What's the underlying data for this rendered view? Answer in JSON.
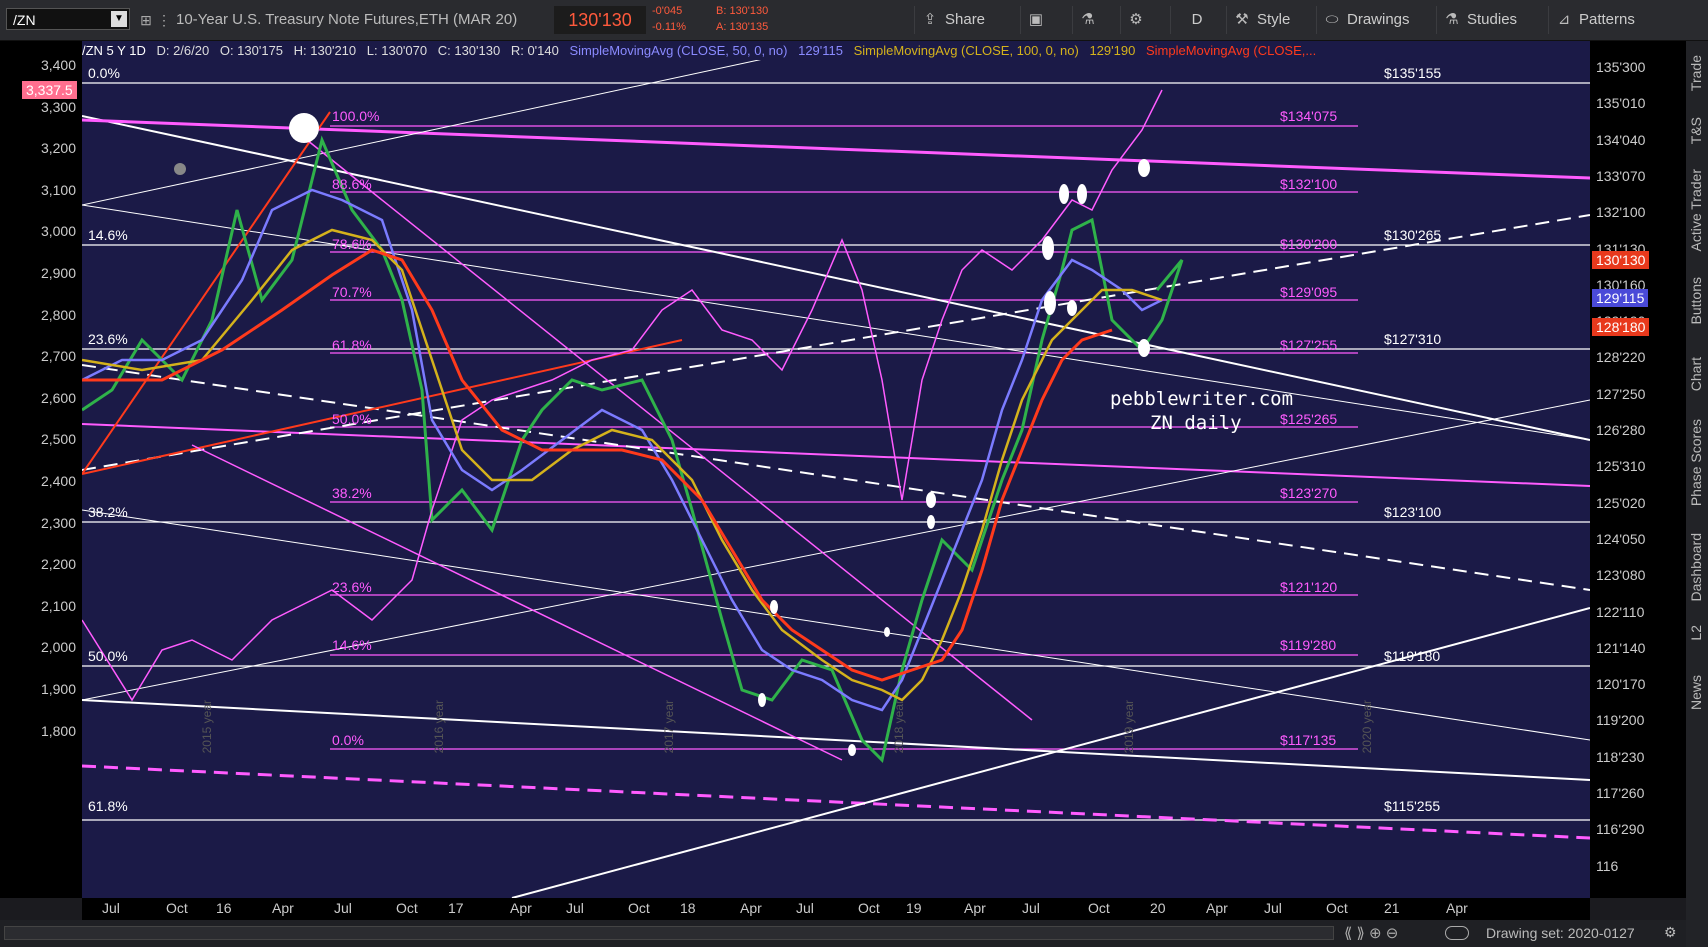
{
  "toolbar": {
    "symbol": "/ZN",
    "instrument": "10-Year U.S. Treasury Note Futures,ETH (MAR 20)",
    "last": "130'130",
    "change": "-0'045",
    "change_pct": "-0.11%",
    "bid": "B: 130'130",
    "ask": "A: 130'135",
    "share": "Share",
    "period": "D",
    "style": "Style",
    "drawings": "Drawings",
    "studies": "Studies",
    "patterns": "Patterns"
  },
  "infobar": {
    "symbol": "/ZN 5 Y 1D",
    "date": "D: 2/6/20",
    "open": "O: 130'175",
    "high": "H: 130'210",
    "low": "L: 130'070",
    "close": "C: 130'130",
    "range": "R: 0'140",
    "sma50": "SimpleMovingAvg (CLOSE, 50, 0, no)",
    "sma50_val": "129'115",
    "sma100": "SimpleMovingAvg (CLOSE, 100, 0, no)",
    "sma100_val": "129'190",
    "sma200": "SimpleMovingAvg (CLOSE,..."
  },
  "left_axis": {
    "ticks": [
      "3,400",
      "3,300",
      "3,200",
      "3,100",
      "3,000",
      "2,900",
      "2,800",
      "2,700",
      "2,600",
      "2,500",
      "2,400",
      "2,300",
      "2,200",
      "2,100",
      "2,000",
      "1,900",
      "1,800"
    ],
    "flag": "3,337.5"
  },
  "right_axis": {
    "ticks": [
      "135'300",
      "135'010",
      "134'040",
      "133'070",
      "132'100",
      "131'130",
      "130'160",
      "129'190",
      "128'220",
      "127'250",
      "126'280",
      "125'310",
      "125'020",
      "124'050",
      "123'080",
      "122'110",
      "121'140",
      "120'170",
      "119'200",
      "118'230",
      "117'260",
      "116'290",
      "116"
    ],
    "last_flag": "130'130",
    "sma50_flag": "129'115",
    "sma200_flag": "128'180"
  },
  "x_axis": [
    "Jul",
    "Oct",
    "16",
    "Apr",
    "Jul",
    "Oct",
    "17",
    "Apr",
    "Jul",
    "Oct",
    "18",
    "Apr",
    "Jul",
    "Oct",
    "19",
    "Apr",
    "Jul",
    "Oct",
    "20",
    "Apr",
    "Jul",
    "Oct",
    "21",
    "Apr"
  ],
  "year_marks": [
    "2015 year",
    "2016 year",
    "2017 year",
    "2018 year",
    "2019 year",
    "2020 year"
  ],
  "fib_left": [
    "0.0%",
    "14.6%",
    "23.6%",
    "38.2%",
    "50.0%",
    "61.8%"
  ],
  "fib_inner": [
    "100.0%",
    "88.6%",
    "78.6%",
    "70.7%",
    "61.8%",
    "50.0%",
    "38.2%",
    "23.6%",
    "14.6%",
    "0.0%"
  ],
  "fib_prices_magenta": [
    "$134'075",
    "$132'100",
    "$130'200",
    "$129'095",
    "$127'255",
    "$125'265",
    "$123'270",
    "$121'120",
    "$119'280",
    "$117'135"
  ],
  "fib_prices_white": [
    "$135'155",
    "$130'265",
    "$127'310",
    "$123'100",
    "$119'180",
    "$115'255"
  ],
  "watermark": [
    "pebblewriter.com",
    "ZN daily"
  ],
  "sidebar": [
    "Trade",
    "T&S",
    "Active Trader",
    "Buttons",
    "Chart",
    "Phase Scores",
    "Dashboard",
    "L2",
    "News"
  ],
  "bottom": {
    "drawing_set": "Drawing set: 2020-0127"
  },
  "colors": {
    "bg": "#1b1a47",
    "magenta": "#ff5cff",
    "sma50": "#7b7bff",
    "sma100": "#d4b21c",
    "sma200": "#ff3a1c"
  }
}
